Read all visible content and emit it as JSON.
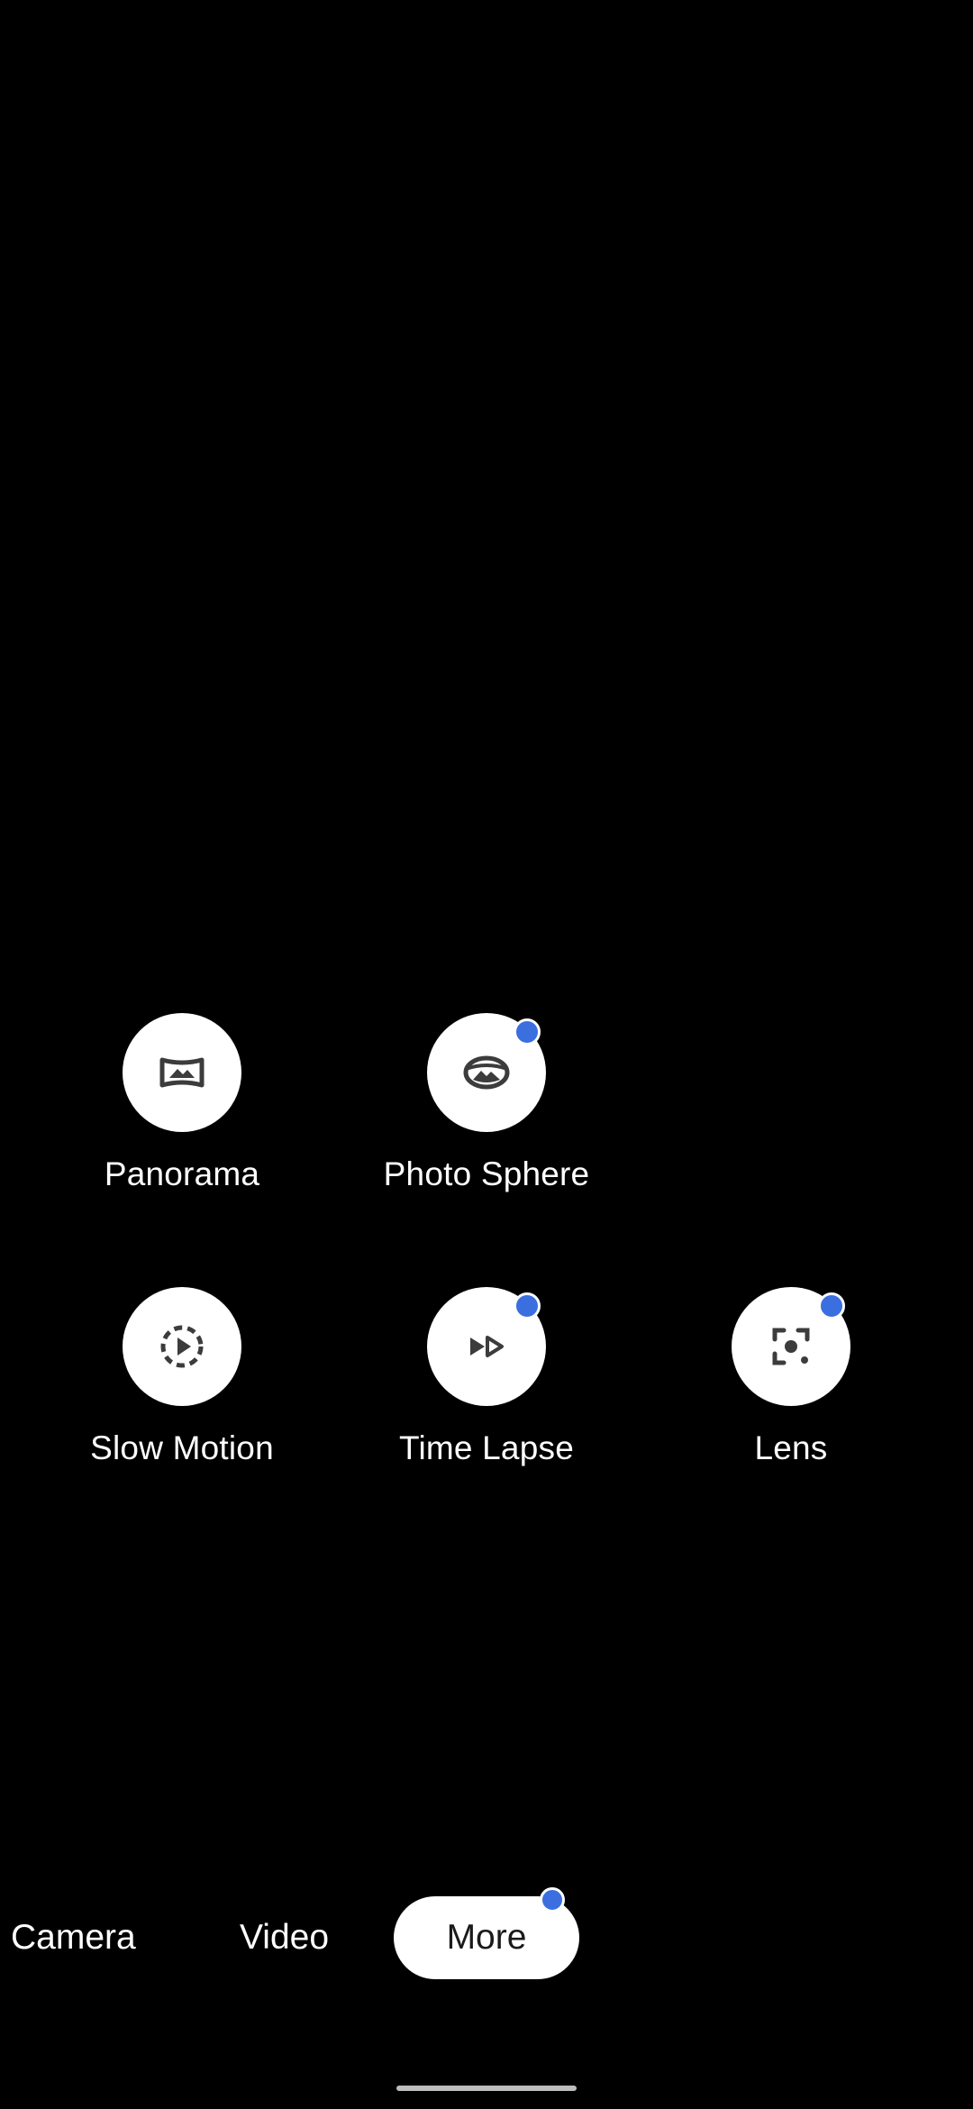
{
  "modes": [
    {
      "id": "panorama",
      "label": "Panorama",
      "icon": "panorama-icon",
      "new": false
    },
    {
      "id": "photo_sphere",
      "label": "Photo Sphere",
      "icon": "photo-sphere-icon",
      "new": true
    },
    {
      "id": "slow_motion",
      "label": "Slow Motion",
      "icon": "slow-motion-icon",
      "new": false
    },
    {
      "id": "time_lapse",
      "label": "Time Lapse",
      "icon": "time-lapse-icon",
      "new": true
    },
    {
      "id": "lens",
      "label": "Lens",
      "icon": "lens-icon",
      "new": true
    }
  ],
  "switcher": {
    "camera": "Camera",
    "video": "Video",
    "more": "More",
    "active": "More",
    "more_new": true
  },
  "colors": {
    "background": "#000000",
    "tile": "#ffffff",
    "icon": "#3c3c3c",
    "new_dot": "#3b6fe0",
    "active_text": "#1a1a1a"
  }
}
